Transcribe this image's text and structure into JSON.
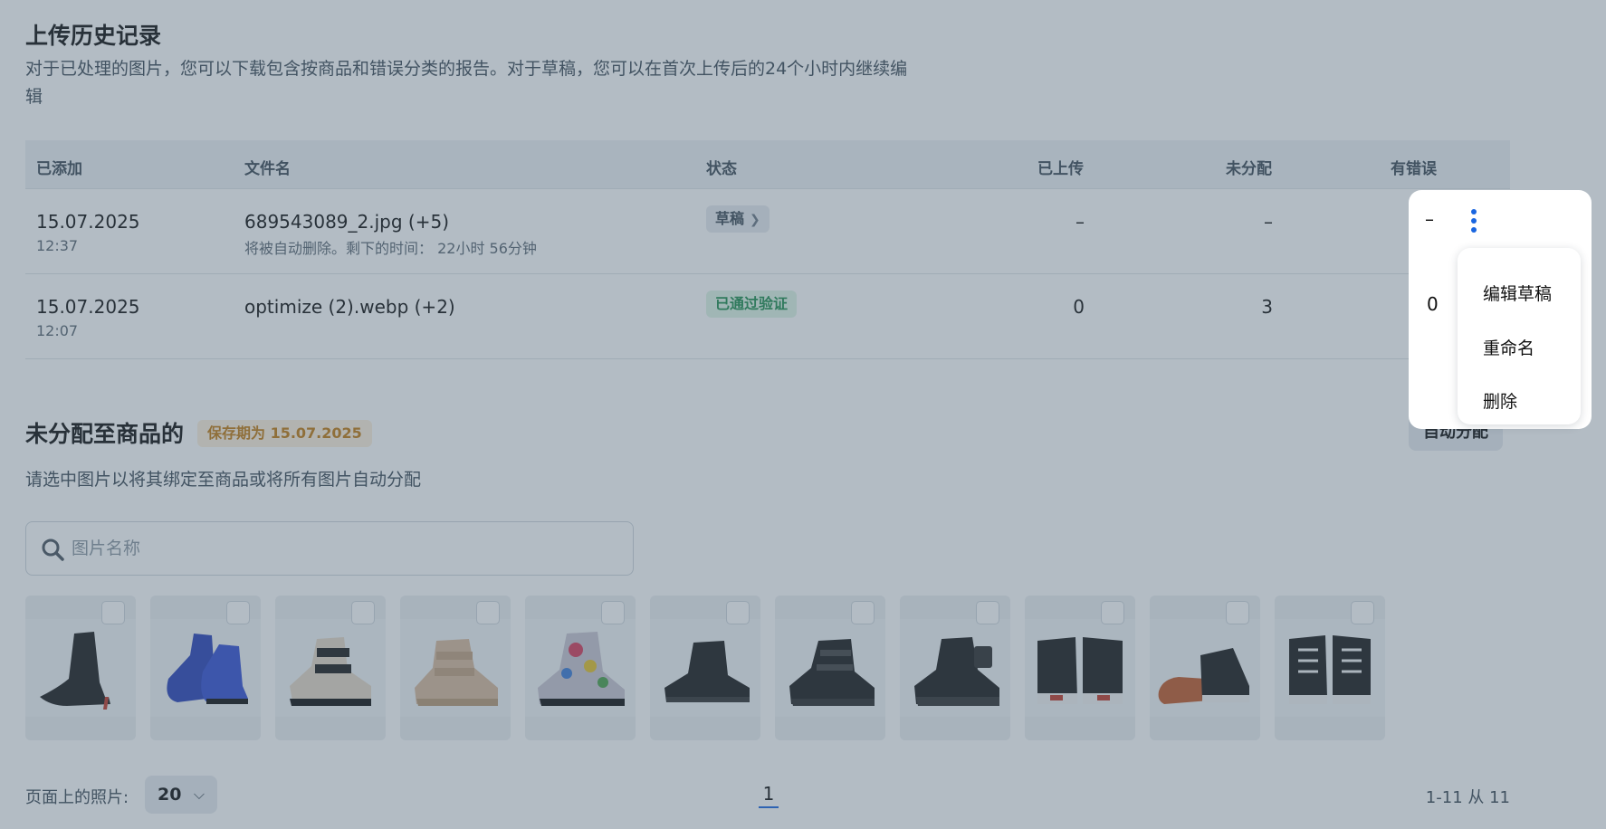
{
  "history": {
    "title": "上传历史记录",
    "description": "对于已处理的图片，您可以下载包含按商品和错误分类的报告。对于草稿，您可以在首次上传后的24个小时内继续编辑",
    "columns": {
      "added": "已添加",
      "filename": "文件名",
      "status": "状态",
      "uploaded": "已上传",
      "unassigned": "未分配",
      "errors": "有错误"
    },
    "rows": [
      {
        "date": "15.07.2025",
        "time": "12:37",
        "filename": "689543089_2.jpg (+5)",
        "note": "将被自动删除。剩下的时间： 22小时 56分钟",
        "status": "草稿",
        "uploaded": "–",
        "unassigned": "–",
        "errors": "–"
      },
      {
        "date": "15.07.2025",
        "time": "12:07",
        "filename": "optimize (2).webp (+2)",
        "status": "已通过验证",
        "uploaded": "0",
        "unassigned": "3",
        "errors": "0"
      }
    ]
  },
  "menu": {
    "items": [
      "编辑草稿",
      "重命名",
      "删除"
    ]
  },
  "unassigned": {
    "title": "未分配至商品的",
    "keep_badge": "保存期为 15.07.2025",
    "auto_button": "自动分配",
    "description": "请选中图片以将其绑定至商品或将所有图片自动分配",
    "search_placeholder": "图片名称",
    "thumbnails": [
      {
        "icon": "ankle-boot-heel-black-icon"
      },
      {
        "icon": "boot-blue-metallic-icon"
      },
      {
        "icon": "boot-beige-black-strap-icon"
      },
      {
        "icon": "boot-gold-strap-icon"
      },
      {
        "icon": "boot-graffiti-print-icon"
      },
      {
        "icon": "boot-black-low-icon"
      },
      {
        "icon": "boot-black-buckle-icon"
      },
      {
        "icon": "boot-black-pouch-icon"
      },
      {
        "icon": "sneaker-high-black-pair-icon"
      },
      {
        "icon": "sneaker-high-black-side-icon"
      },
      {
        "icon": "sneaker-high-black-front-icon"
      }
    ]
  },
  "footer": {
    "per_page_label": "页面上的照片:",
    "per_page_value": "20",
    "current_page": "1",
    "range": "1-11 从 11"
  },
  "colors": {
    "accent": "#1a66e0",
    "success": "#1e8e4e",
    "warning": "#c27a12"
  }
}
